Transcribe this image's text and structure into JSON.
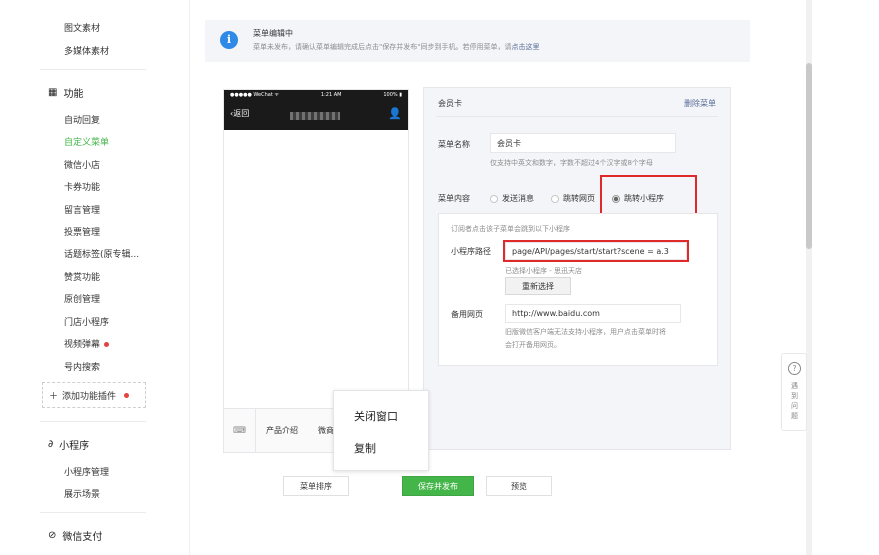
{
  "sidebar": {
    "top_items": [
      "图文素材",
      "多媒体素材"
    ],
    "function_section": {
      "title": "功能",
      "items": [
        {
          "label": "自动回复",
          "active": false
        },
        {
          "label": "自定义菜单",
          "active": true
        },
        {
          "label": "微信小店",
          "active": false
        },
        {
          "label": "卡券功能",
          "active": false
        },
        {
          "label": "留言管理",
          "active": false
        },
        {
          "label": "投票管理",
          "active": false
        },
        {
          "label": "话题标签(原专辑...",
          "active": false
        },
        {
          "label": "赞赏功能",
          "active": false
        },
        {
          "label": "原创管理",
          "active": false
        },
        {
          "label": "门店小程序",
          "active": false
        },
        {
          "label": "视频弹幕",
          "active": false
        },
        {
          "label": "号内搜索",
          "active": false
        }
      ],
      "add_plugin": "添加功能插件"
    },
    "miniprogram_section": {
      "title": "小程序",
      "items": [
        "小程序管理",
        "展示场景"
      ]
    },
    "pay_section": {
      "title": "微信支付"
    }
  },
  "notice": {
    "icon": "info-icon",
    "title": "菜单编辑中",
    "text_before": "菜单未发布，请确认菜单编辑完成后点击\"保存并发布\"同步到手机。若停用菜单，请",
    "link": "点击这里"
  },
  "phone": {
    "status_carrier": "●●●●● WeChat ᯤ",
    "status_time": "1:21 AM",
    "status_battery": "100% ▮",
    "back": "返回",
    "menu_tabs": [
      "产品介绍",
      "微商"
    ]
  },
  "editor": {
    "title": "会员卡",
    "delete": "删除菜单",
    "name_label": "菜单名称",
    "name_value": "会员卡",
    "name_hint": "仅支持中英文和数字，字数不超过4个汉字或8个字母",
    "content_label": "菜单内容",
    "options": [
      {
        "label": "发送消息",
        "selected": false
      },
      {
        "label": "跳转网页",
        "selected": false
      },
      {
        "label": "跳转小程序",
        "selected": true
      }
    ],
    "sub_hint": "订阅者点击该子菜单会跳到以下小程序",
    "path_label": "小程序路径",
    "path_value": "page/API/pages/start/start?scene = a.3",
    "selected_info": "已选择小程序 - 思迅天店",
    "reselect": "重新选择",
    "backup_label": "备用网页",
    "backup_value": "http://www.baidu.com",
    "backup_hint_1": "旧版微信客户端无法支持小程序，用户点击菜单时将",
    "backup_hint_2": "会打开备用网页。"
  },
  "bottom": {
    "sort": "菜单排序",
    "save": "保存并发布",
    "preview": "预览"
  },
  "context_menu": {
    "items": [
      "关闭窗口",
      "复制"
    ]
  },
  "feedback": {
    "icon": "question-icon",
    "text": "遇到问题"
  },
  "colors": {
    "accent_green": "#44b549",
    "link_blue": "#576b95",
    "highlight_red": "#e02a2a",
    "info_blue": "#2e8ae6"
  }
}
